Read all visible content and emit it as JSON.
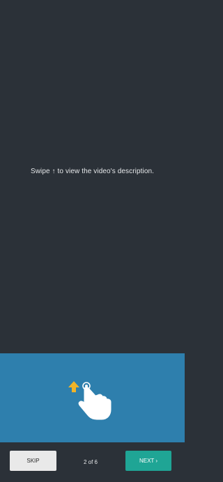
{
  "tutorial": {
    "instruction": "Swipe ↑ to view the video's description."
  },
  "gesture": {
    "arrow_icon": "arrow-up-icon",
    "hand_icon": "swipe-hand-icon",
    "arrow_color": "#f0b429",
    "panel_color": "#2e7fad"
  },
  "footer": {
    "skip_label": "SKIP",
    "page_indicator": "2 of 6",
    "next_label": "NEXT ›",
    "next_color": "#1fa595"
  }
}
